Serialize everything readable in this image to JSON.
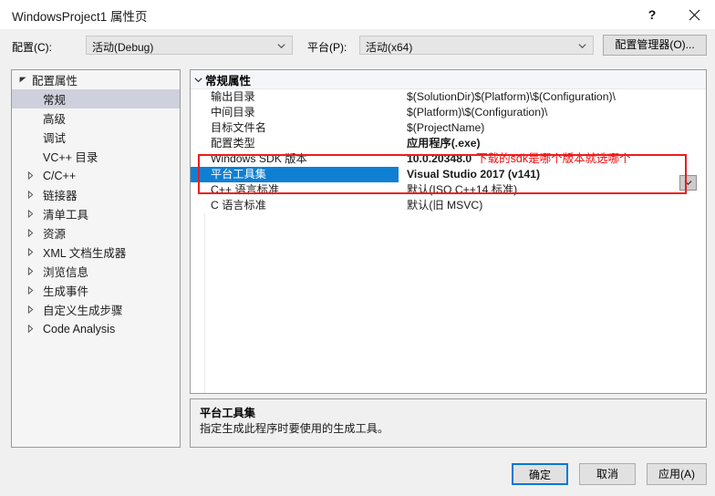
{
  "window": {
    "title": "WindowsProject1 属性页",
    "help_icon": "question-mark-icon",
    "help_label": "?",
    "close_icon": "close-icon"
  },
  "toolbar": {
    "config_label": "配置(C):",
    "config_value": "活动(Debug)",
    "platform_label": "平台(P):",
    "platform_value": "活动(x64)",
    "config_manager_label": "配置管理器(O)..."
  },
  "tree": {
    "items": [
      {
        "label": "配置属性",
        "indent": 0,
        "arrow": "expanded",
        "selected": false
      },
      {
        "label": "常规",
        "indent": 1,
        "arrow": "none",
        "selected": true
      },
      {
        "label": "高级",
        "indent": 1,
        "arrow": "none",
        "selected": false
      },
      {
        "label": "调试",
        "indent": 1,
        "arrow": "none",
        "selected": false
      },
      {
        "label": "VC++ 目录",
        "indent": 1,
        "arrow": "none",
        "selected": false
      },
      {
        "label": "C/C++",
        "indent": 1,
        "arrow": "collapsed",
        "selected": false
      },
      {
        "label": "链接器",
        "indent": 1,
        "arrow": "collapsed",
        "selected": false
      },
      {
        "label": "清单工具",
        "indent": 1,
        "arrow": "collapsed",
        "selected": false
      },
      {
        "label": "资源",
        "indent": 1,
        "arrow": "collapsed",
        "selected": false
      },
      {
        "label": "XML 文档生成器",
        "indent": 1,
        "arrow": "collapsed",
        "selected": false
      },
      {
        "label": "浏览信息",
        "indent": 1,
        "arrow": "collapsed",
        "selected": false
      },
      {
        "label": "生成事件",
        "indent": 1,
        "arrow": "collapsed",
        "selected": false
      },
      {
        "label": "自定义生成步骤",
        "indent": 1,
        "arrow": "collapsed",
        "selected": false
      },
      {
        "label": "Code Analysis",
        "indent": 1,
        "arrow": "collapsed",
        "selected": false
      }
    ]
  },
  "grid": {
    "category": "常规属性",
    "rows": [
      {
        "name": "输出目录",
        "value": "$(SolutionDir)$(Platform)\\$(Configuration)\\",
        "bold": false,
        "selected": false
      },
      {
        "name": "中间目录",
        "value": "$(Platform)\\$(Configuration)\\",
        "bold": false,
        "selected": false
      },
      {
        "name": "目标文件名",
        "value": "$(ProjectName)",
        "bold": false,
        "selected": false
      },
      {
        "name": "配置类型",
        "value": "应用程序(.exe)",
        "bold": true,
        "selected": false
      },
      {
        "name": "Windows SDK 版本",
        "value": "10.0.20348.0",
        "bold": true,
        "selected": false,
        "annotation": "下载的sdk是哪个版本就选哪个"
      },
      {
        "name": "平台工具集",
        "value": "Visual Studio 2017 (v141)",
        "bold": true,
        "selected": true
      },
      {
        "name": "C++ 语言标准",
        "value": "默认(ISO C++14 标准)",
        "bold": false,
        "selected": false
      },
      {
        "name": "C 语言标准",
        "value": "默认(旧 MSVC)",
        "bold": false,
        "selected": false
      }
    ],
    "dropdown_icon": "chevron-down-icon"
  },
  "description": {
    "title": "平台工具集",
    "text": "指定生成此程序时要使用的生成工具。"
  },
  "footer": {
    "ok_label": "确定",
    "cancel_label": "取消",
    "apply_label": "应用(A)"
  },
  "colors": {
    "selection_blue": "#0f7fd4",
    "tree_selection": "#cfd0dd",
    "annotation_red": "#ee1c1c",
    "focus_border": "#0078d7",
    "dialog_bg": "#f0f0f0"
  }
}
